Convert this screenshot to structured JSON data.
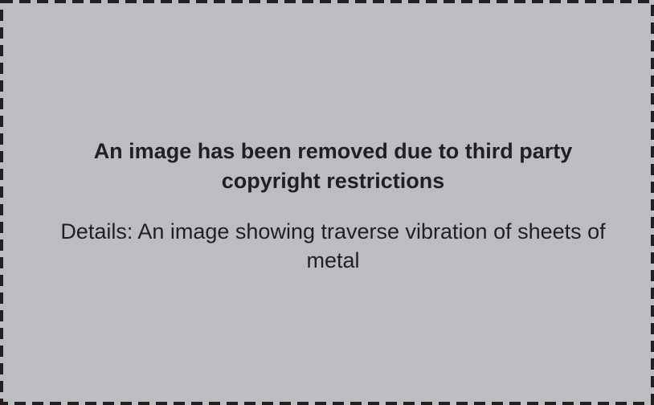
{
  "notice": {
    "title": "An image has been removed due to third party copyright restrictions",
    "details": "Details: An image showing traverse vibration of sheets of metal"
  },
  "colors": {
    "panel_background": "#bcbdc0",
    "border": "#231f20",
    "text": "#231f20"
  }
}
